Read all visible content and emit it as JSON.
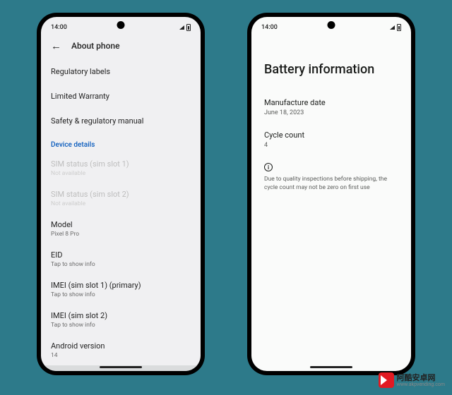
{
  "statusbar": {
    "time": "14:00"
  },
  "left": {
    "title": "About phone",
    "items": [
      {
        "label": "Regulatory labels"
      },
      {
        "label": "Limited Warranty"
      },
      {
        "label": "Safety & regulatory manual"
      }
    ],
    "section_header": "Device details",
    "disabled": [
      {
        "label": "SIM status (sim slot 1)",
        "sub": "Not available"
      },
      {
        "label": "SIM status (sim slot 2)",
        "sub": "Not available"
      }
    ],
    "details": [
      {
        "label": "Model",
        "sub": "Pixel 8 Pro"
      },
      {
        "label": "EID",
        "sub": "Tap to show info"
      },
      {
        "label": "IMEI (sim slot 1) (primary)",
        "sub": "Tap to show info"
      },
      {
        "label": "IMEI (sim slot 2)",
        "sub": "Tap to show info"
      },
      {
        "label": "Android version",
        "sub": "14"
      }
    ],
    "selected": "Battery information"
  },
  "right": {
    "title": "Battery information",
    "manufacture": {
      "label": "Manufacture date",
      "value": "June 18, 2023"
    },
    "cycle": {
      "label": "Cycle count",
      "value": "4"
    },
    "note": "Due to quality inspections before shipping, the cycle count may not be zero on first use"
  },
  "watermark": {
    "cn": "阿酷安卓网",
    "url": "www.akpvending.com"
  }
}
